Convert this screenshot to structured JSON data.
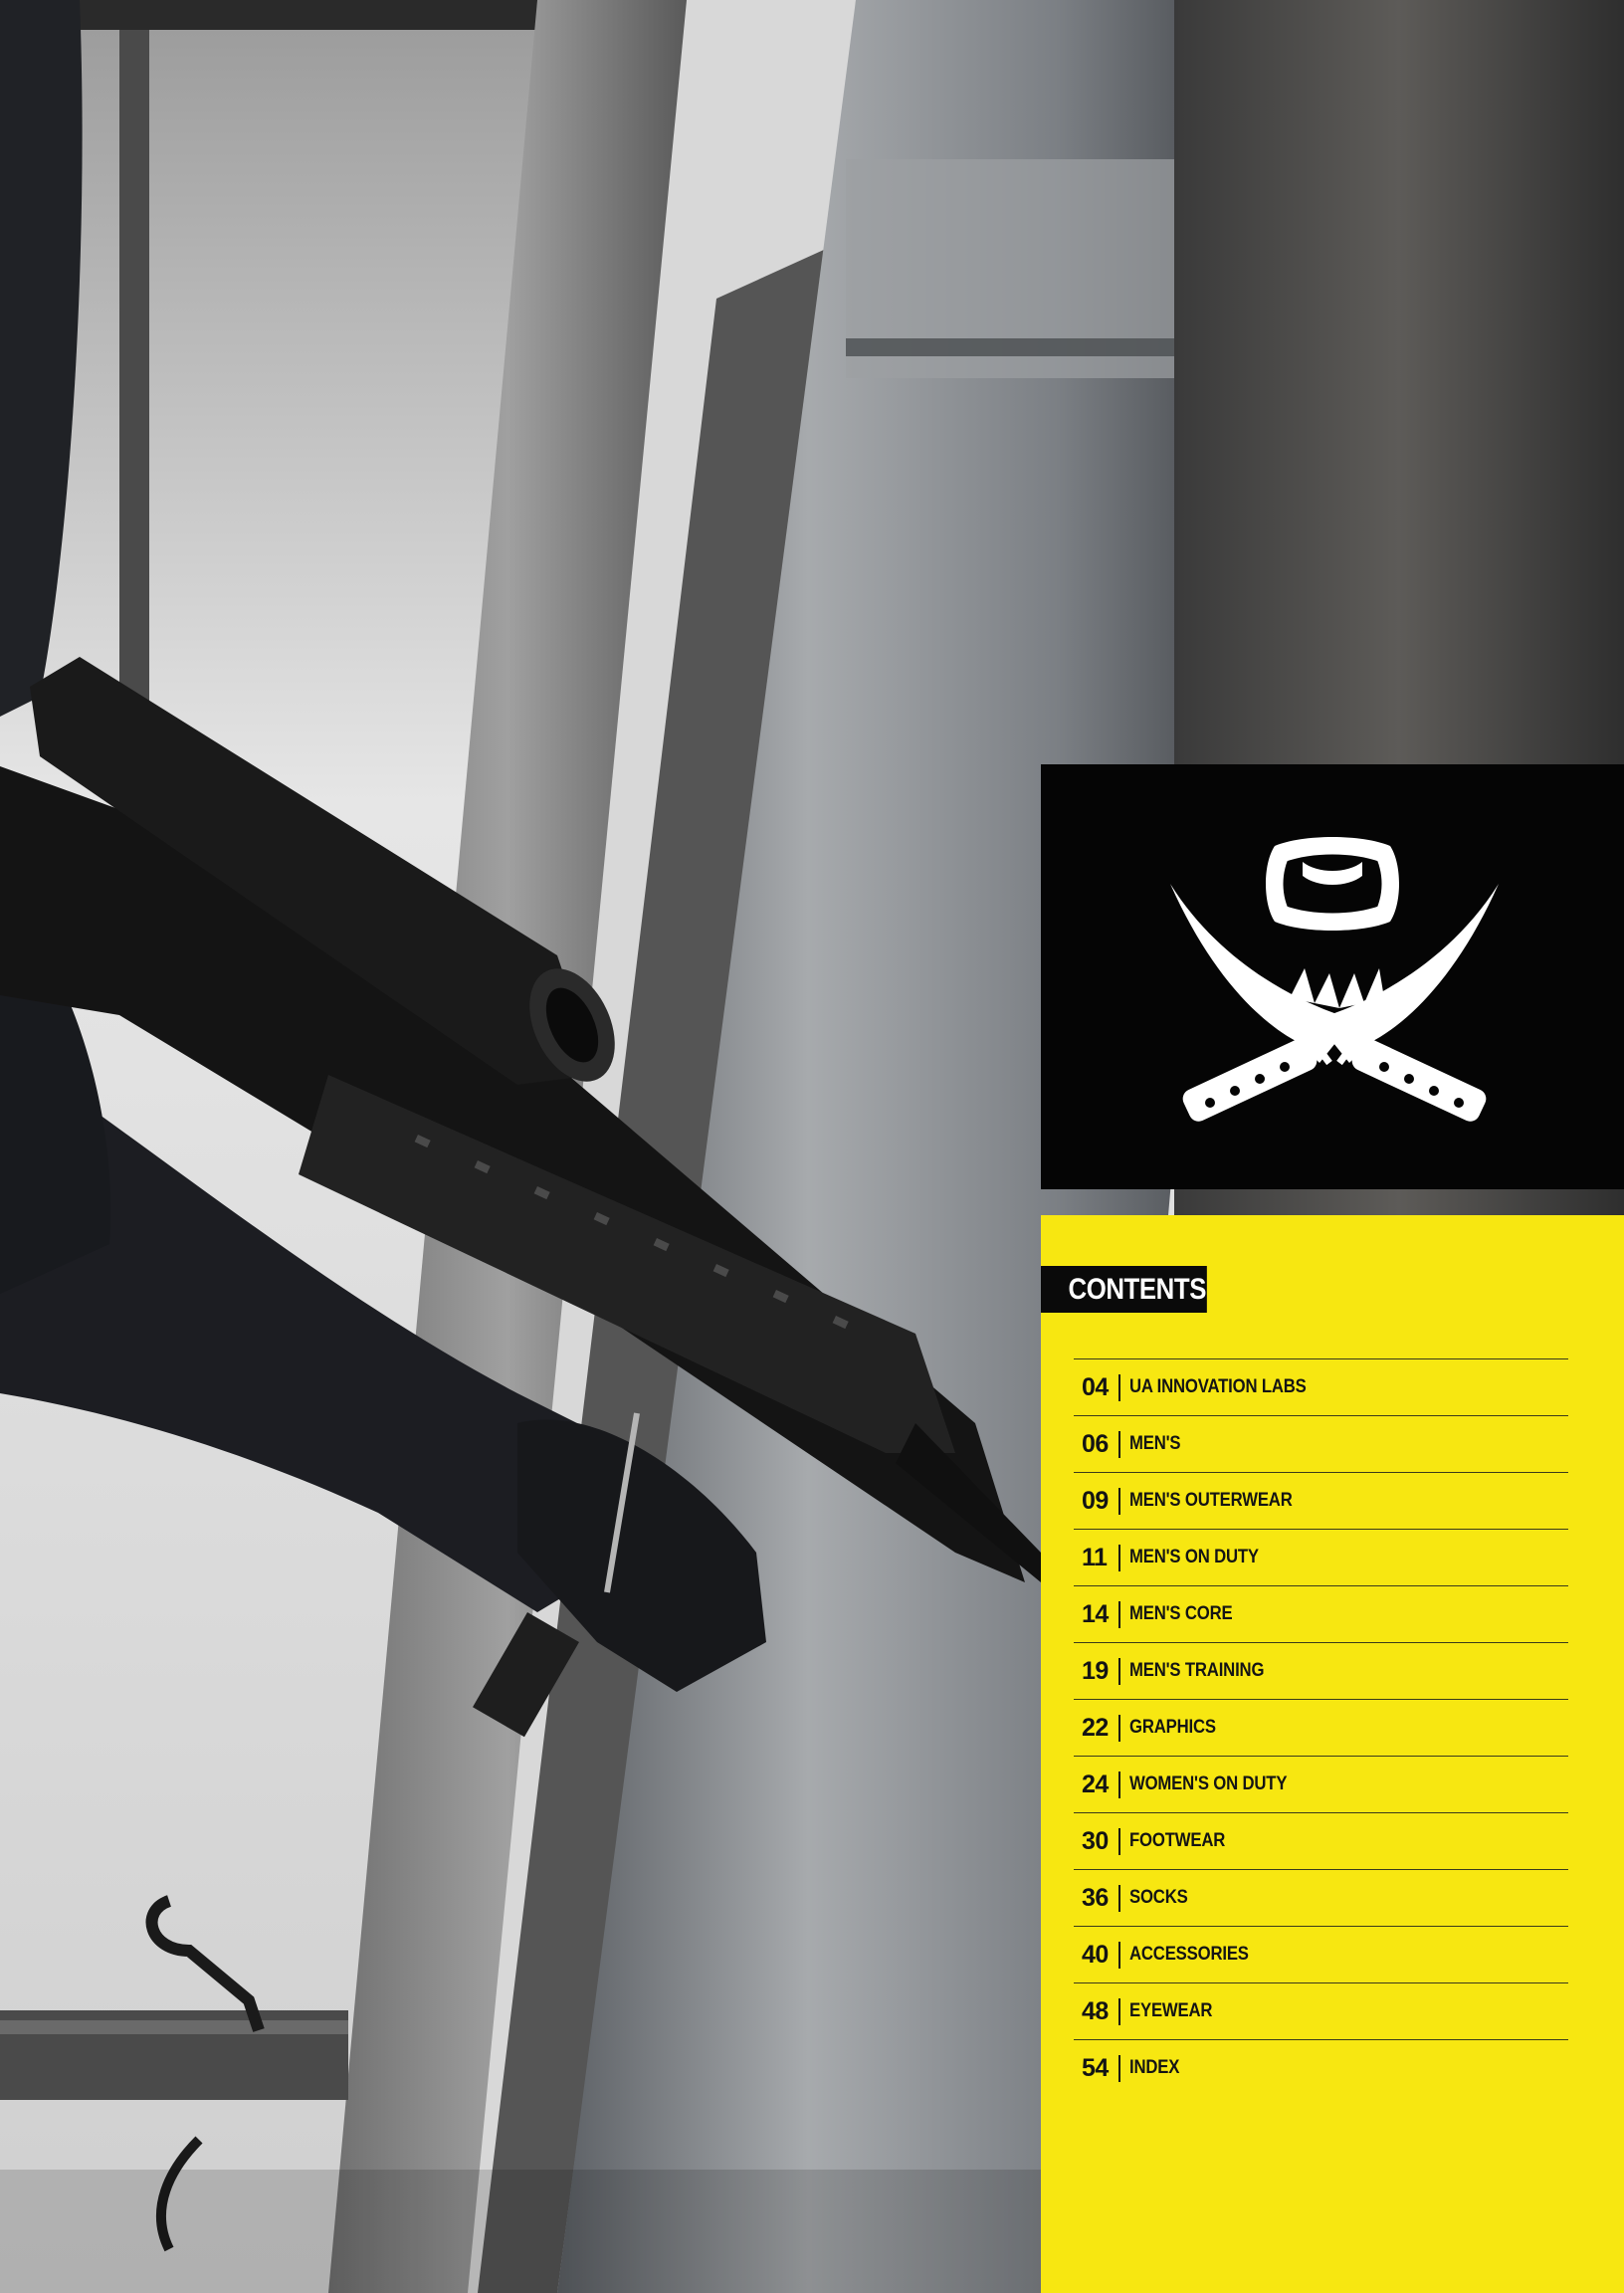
{
  "colors": {
    "panel_yellow": "#f7e711",
    "panel_black": "#050505",
    "text_dark": "#141414",
    "heading_text": "#ffffff"
  },
  "logo": {
    "icon": "under-armour-crossed-blades-logo"
  },
  "contents": {
    "heading": "CONTENTS",
    "items": [
      {
        "page": "04",
        "label": "UA INNOVATION LABS"
      },
      {
        "page": "06",
        "label": "MEN'S"
      },
      {
        "page": "09",
        "label": "MEN'S OUTERWEAR"
      },
      {
        "page": "11",
        "label": "MEN'S ON DUTY"
      },
      {
        "page": "14",
        "label": "MEN'S CORE"
      },
      {
        "page": "19",
        "label": "MEN'S TRAINING"
      },
      {
        "page": "22",
        "label": "GRAPHICS"
      },
      {
        "page": "24",
        "label": "WOMEN'S ON DUTY"
      },
      {
        "page": "30",
        "label": "FOOTWEAR"
      },
      {
        "page": "36",
        "label": "SOCKS"
      },
      {
        "page": "40",
        "label": "ACCESSORIES"
      },
      {
        "page": "48",
        "label": "EYEWEAR"
      },
      {
        "page": "54",
        "label": "INDEX"
      }
    ]
  }
}
